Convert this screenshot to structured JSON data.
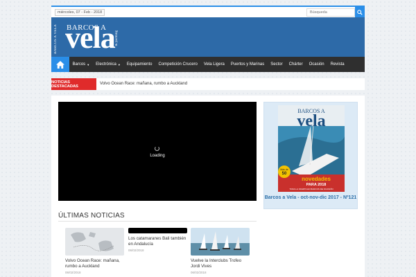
{
  "topbar": {
    "date": "miércoles, 07 - Feb - 2018",
    "search_placeholder": "Búsqueda"
  },
  "header": {
    "logo_top": "BARCOS A",
    "logo_main": "vela",
    "logo_side": "BARCOS A VELA",
    "logo_yachting": "& yachting"
  },
  "nav": {
    "items": [
      {
        "label": "Barcos",
        "has_caret": true
      },
      {
        "label": "Electrónica",
        "has_caret": true
      },
      {
        "label": "Equipamiento",
        "has_caret": false
      },
      {
        "label": "Competición Crucero",
        "has_caret": false
      },
      {
        "label": "Vela Ligera",
        "has_caret": false
      },
      {
        "label": "Puertos y Marinas",
        "has_caret": false
      },
      {
        "label": "Sector",
        "has_caret": false
      },
      {
        "label": "Chárter",
        "has_caret": false
      },
      {
        "label": "Ocasión",
        "has_caret": false
      },
      {
        "label": "Revista",
        "has_caret": false
      }
    ]
  },
  "breaking": {
    "label": "NOTICIAS DESTACADAS",
    "text": "Volvo Ocean Race: mañana, rumbo a Auckland"
  },
  "video": {
    "loading": "Loading"
  },
  "sidebar": {
    "caption": "Barcos a Vela - oct-nov-dic 2017 - Nº121",
    "cover_title": "BARCOS A",
    "cover_vela": "vela",
    "cover_badge_top": "Más de",
    "cover_badge_num": "50",
    "cover_novedades": "novedades",
    "cover_year": "PARA 2018",
    "cover_bottom": "TODA LA OFERTA EN BARCOS DE OCASIÓN"
  },
  "news": {
    "title": "ÚLTIMAS NOTICIAS",
    "cards": [
      {
        "title": "Volvo Ocean Race: mañana, rumbo a Auckland",
        "date": "06/02/2018"
      },
      {
        "title": "Los catamaranes Bali también en Andalucía",
        "date": "06/02/2018"
      },
      {
        "title": "Vuelve la Interclubs Trofeo Jordi Vives",
        "date": "06/02/2018"
      }
    ]
  },
  "colors": {
    "accent": "#2a8ee8",
    "header": "#2d6aa8",
    "nav": "#2f2f2f",
    "breaking": "#e02b2b"
  }
}
